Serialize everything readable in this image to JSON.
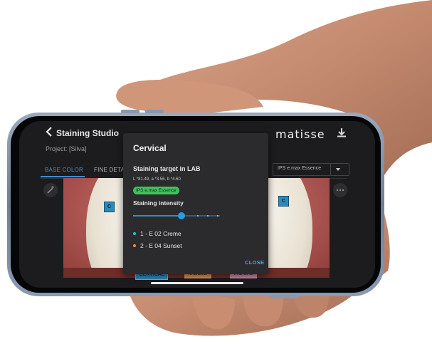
{
  "app": {
    "title": "Staining Studio",
    "project": "Project: [Silva]",
    "logo": "matisse"
  },
  "tabs": [
    "BASE COLOR",
    "FINE DETAIL"
  ],
  "material_select": {
    "value": "IPS e.max Essence"
  },
  "photo": {
    "markers": [
      "C",
      "C"
    ],
    "zone_buttons": [
      "CERVICAL",
      "MIDDLE",
      "INCISAL"
    ]
  },
  "dialog": {
    "title": "Cervical",
    "lab_title": "Staining target in LAB",
    "lab_values": "L *81.49, a *3.56, b *4.60",
    "badge": "IPS e.max Essence",
    "intensity_label": "Staining intensity",
    "intensity": 0.54,
    "stains": [
      {
        "label": "1 - E 02 Creme",
        "color": "#27c3d6"
      },
      {
        "label": "2 - E 04 Sunset",
        "color": "#f08a4b"
      }
    ],
    "close_label": "CLOSE"
  },
  "colors": {
    "accent": "#3e8fd6",
    "badge": "#3ec25a",
    "cervical": "#2f88b8",
    "middle": "#d9925a",
    "incisal": "#c98aa8"
  },
  "icons": [
    "back-chevron-icon",
    "download-icon",
    "magic-wand-icon",
    "more-icon"
  ]
}
